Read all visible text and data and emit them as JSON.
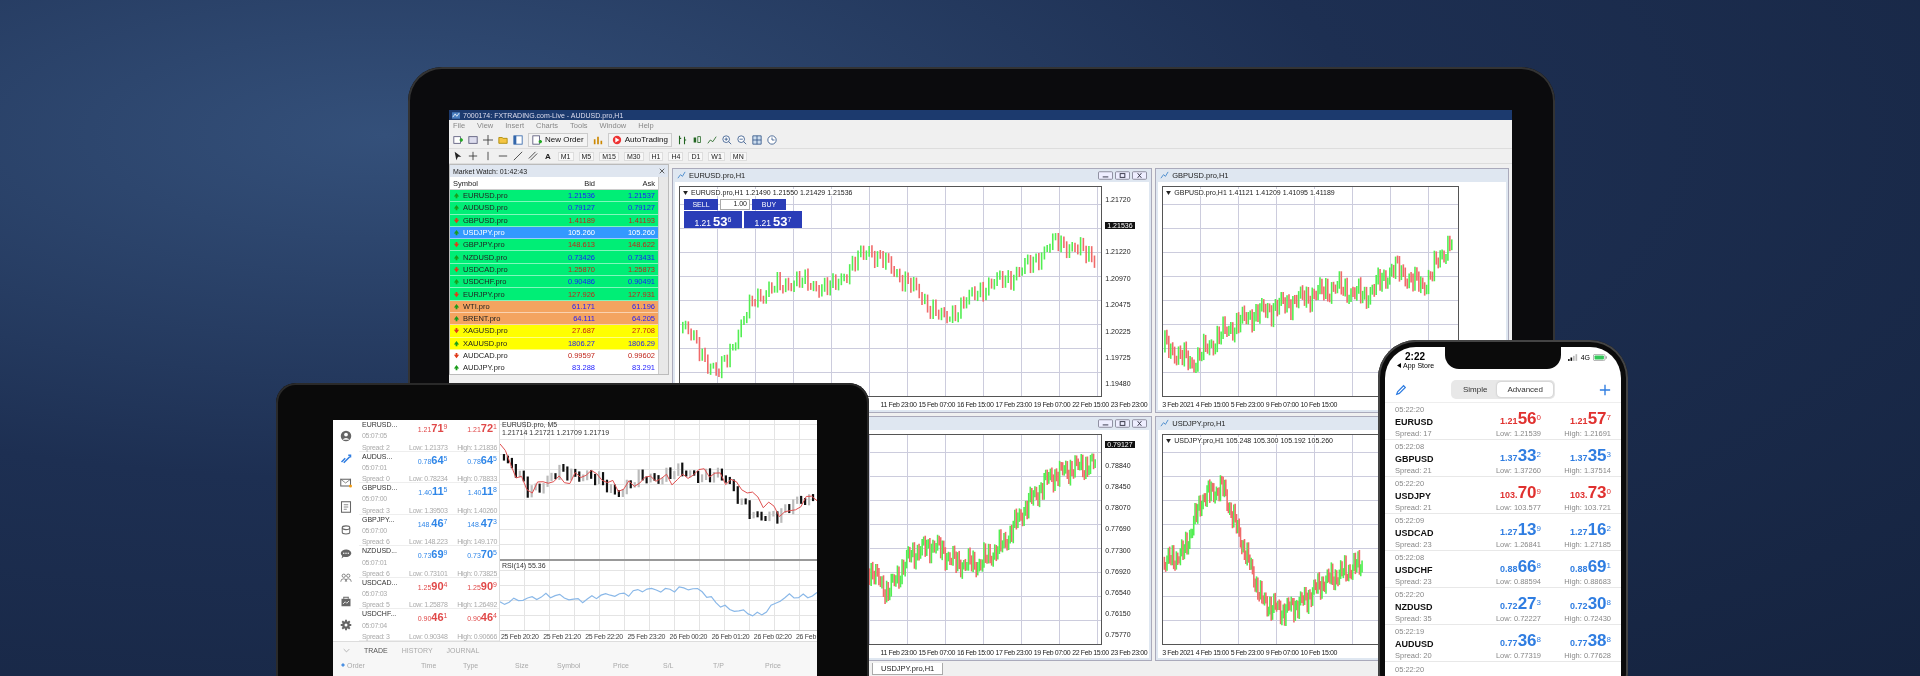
{
  "desktop": {
    "title": "7000174: FXTRADING.com-Live - AUDUSD.pro,H1",
    "menu": [
      "File",
      "View",
      "Insert",
      "Charts",
      "Tools",
      "Window",
      "Help"
    ],
    "toolbar_buttons": [
      "New Order",
      "AutoTrading"
    ],
    "text_tool": "A",
    "timeframes": [
      "M1",
      "M5",
      "M15",
      "M30",
      "H1",
      "H4",
      "D1",
      "W1",
      "MN"
    ],
    "market_watch": {
      "title": "Market Watch: 01:42:43",
      "columns": [
        "Symbol",
        "Bid",
        "Ask"
      ],
      "rows": [
        {
          "symbol": "EURUSD.pro",
          "bid": "1.21536",
          "ask": "1.21537",
          "falling": false,
          "color": "#00ee76",
          "selected": false
        },
        {
          "symbol": "AUDUSD.pro",
          "bid": "0.79127",
          "ask": "0.79127",
          "falling": false,
          "color": "#00ee76",
          "selected": false
        },
        {
          "symbol": "GBPUSD.pro",
          "bid": "1.41189",
          "ask": "1.41193",
          "falling": true,
          "color": "#00ee76",
          "selected": false
        },
        {
          "symbol": "USDJPY.pro",
          "bid": "105.260",
          "ask": "105.260",
          "falling": false,
          "selected": true
        },
        {
          "symbol": "GBPJPY.pro",
          "bid": "148.613",
          "ask": "148.622",
          "falling": true,
          "color": "#00ee76",
          "selected": false
        },
        {
          "symbol": "NZDUSD.pro",
          "bid": "0.73426",
          "ask": "0.73431",
          "falling": false,
          "color": "#00ee76",
          "selected": false
        },
        {
          "symbol": "USDCAD.pro",
          "bid": "1.25870",
          "ask": "1.25873",
          "falling": true,
          "color": "#00ee76",
          "selected": false
        },
        {
          "symbol": "USDCHF.pro",
          "bid": "0.90486",
          "ask": "0.90491",
          "falling": false,
          "color": "#00ee76",
          "selected": false
        },
        {
          "symbol": "EURJPY.pro",
          "bid": "127.926",
          "ask": "127.931",
          "falling": true,
          "color": "#00ee76",
          "selected": false
        },
        {
          "symbol": "WTI.pro",
          "bid": "61.171",
          "ask": "61.196",
          "falling": false,
          "color": "#f4a460",
          "selected": false
        },
        {
          "symbol": "BRENT.pro",
          "bid": "64.111",
          "ask": "64.205",
          "falling": false,
          "color": "#f4a460",
          "selected": false
        },
        {
          "symbol": "XAGUSD.pro",
          "bid": "27.687",
          "ask": "27.708",
          "falling": true,
          "color": "#ffff00",
          "selected": false
        },
        {
          "symbol": "XAUUSD.pro",
          "bid": "1806.27",
          "ask": "1806.29",
          "falling": false,
          "color": "#ffff00",
          "selected": false
        },
        {
          "symbol": "AUDCAD.pro",
          "bid": "0.99597",
          "ask": "0.99602",
          "falling": true,
          "color": "#ffffff",
          "selected": false
        },
        {
          "symbol": "AUDJPY.pro",
          "bid": "83.288",
          "ask": "83.291",
          "falling": false,
          "color": "#ffffff",
          "selected": false
        }
      ]
    },
    "chart_rows": [
      [
        {
          "title": "EURUSD.pro,H1",
          "info": "EURUSD.pro,H1 1.21490 1.21550 1.21429 1.21536",
          "price_tag": "1.21536",
          "price_labels": [
            "1.21720",
            "1.21220",
            "1.20970",
            "1.20475",
            "1.20225",
            "1.19725",
            "1.19480"
          ],
          "time_labels": [
            "11 Feb 23:00",
            "15 Feb 07:00",
            "16 Feb 15:00",
            "17 Feb 23:00",
            "19 Feb 07:00",
            "22 Feb 15:00",
            "23 Feb 23:00"
          ],
          "one_click": {
            "sell": "SELL",
            "lots": "1.00",
            "buy": "BUY",
            "sell_price": "1.21**53**$^{6}$",
            "buy_price": "1.21**53**$^{7}$"
          }
        },
        {
          "title": "GBPUSD.pro,H1",
          "info": "GBPUSD.pro,H1 1.41121 1.41209 1.41095 1.41189",
          "time_labels": [
            "3 Feb 2021",
            "4 Feb 15:00",
            "5 Feb 23:00",
            "9 Feb 07:00",
            "10 Feb 15:00"
          ]
        }
      ],
      [
        {
          "price_tag": "0.79127",
          "price_labels": [
            "0.78840",
            "0.78450",
            "0.78070",
            "0.77690",
            "0.77300",
            "0.76920",
            "0.76540",
            "0.76150",
            "0.75770"
          ],
          "time_labels": [
            "11 Feb 23:00",
            "15 Feb 07:00",
            "16 Feb 15:00",
            "17 Feb 23:00",
            "19 Feb 07:00",
            "22 Feb 15:00",
            "23 Feb 23:00"
          ]
        },
        {
          "title": "USDJPY.pro,H1",
          "info": "USDJPY.pro,H1 105.248 105.300 105.192 105.260",
          "time_labels": [
            "3 Feb 2021",
            "4 Feb 15:00",
            "5 Feb 23:00",
            "9 Feb 07:00",
            "10 Feb 15:00"
          ]
        }
      ]
    ],
    "chart_tab": "USDJPY.pro,H1"
  },
  "tablet": {
    "sidebar": [
      {
        "selected": false
      },
      {
        "selected": true
      },
      {
        "selected": false
      },
      {
        "selected": false
      },
      {
        "selected": false
      },
      {
        "selected": false
      },
      {
        "selected": false
      },
      {
        "selected": false
      },
      {
        "selected": false
      }
    ],
    "quotes": [
      {
        "symbol": "EURUSD...",
        "time": "05:07:05",
        "spread": "Spread: 2",
        "bid": "1.21**71**$^{9}$",
        "ask": "1.21**72**$^{1}$",
        "low": "Low: 1.21373",
        "high": "High: 1.21836",
        "falling": true
      },
      {
        "symbol": "AUDUS...",
        "time": "05:07:01",
        "spread": "Spread: 0",
        "bid": "0.78**64**$^{5}$",
        "ask": "0.78**64**$^{5}$",
        "low": "Low: 0.78234",
        "high": "High: 0.78833",
        "falling": false
      },
      {
        "symbol": "GBPUSD...",
        "time": "05:07:00",
        "spread": "Spread: 3",
        "bid": "1.40**11**$^{5}$",
        "ask": "1.40**11**$^{8}$",
        "low": "Low: 1.39503",
        "high": "High: 1.40260",
        "falling": false
      },
      {
        "symbol": "GBPJPY...",
        "time": "05:07:00",
        "spread": "Spread: 6",
        "bid": "148.**46**$^{7}$",
        "ask": "148.**47**$^{3}$",
        "low": "Low: 148.223",
        "high": "High: 149.170",
        "falling": false
      },
      {
        "symbol": "NZDUSD...",
        "time": "05:07:01",
        "spread": "Spread: 6",
        "bid": "0.73**69**$^{9}$",
        "ask": "0.73**70**$^{5}$",
        "low": "Low: 0.73101",
        "high": "High: 0.73825",
        "falling": false
      },
      {
        "symbol": "USDCAD...",
        "time": "05:07:03",
        "spread": "Spread: 5",
        "bid": "1.25**90**$^{4}$",
        "ask": "1.25**90**$^{9}$",
        "low": "Low: 1.25878",
        "high": "High: 1.26492",
        "falling": true
      },
      {
        "symbol": "USDCHF...",
        "time": "05:07:04",
        "spread": "Spread: 3",
        "bid": "0.90**46**$^{1}$",
        "ask": "0.90**46**$^{4}$",
        "low": "Low: 0.90348",
        "high": "High: 0.90666",
        "falling": true
      }
    ],
    "chart": {
      "title": "EURUSD.pro, M5",
      "info": "1.21714 1.21721 1.21709 1.21719",
      "indicator": "RSI(14) 55.36",
      "time_labels": [
        "25 Feb 20:20",
        "25 Feb 21:20",
        "25 Feb 22:20",
        "25 Feb 23:20",
        "26 Feb 00:20",
        "26 Feb 01:20",
        "26 Feb 02:20",
        "26 Feb"
      ]
    },
    "tabs": [
      {
        "label": "TRADE",
        "selected": true
      },
      {
        "label": "HISTORY",
        "selected": false
      },
      {
        "label": "JOURNAL",
        "selected": false
      }
    ],
    "columns": [
      "Order",
      "Time",
      "Type",
      "Size",
      "Symbol",
      "Price",
      "S/L",
      "T/P",
      "Price"
    ]
  },
  "phone": {
    "time": "2:22",
    "back_label": "App Store",
    "network": "4G",
    "segments": [
      {
        "label": "Simple",
        "selected": false
      },
      {
        "label": "Advanced",
        "selected": true
      }
    ],
    "quotes": [
      {
        "time": "05:22:20",
        "symbol": "EURUSD",
        "spread": "Spread: 17",
        "bid": "1.21**56**$^{0}$",
        "ask": "1.21**57**$^{7}$",
        "low": "Low: 1.21539",
        "high": "High: 1.21691",
        "falling": true
      },
      {
        "time": "05:22:08",
        "symbol": "GBPUSD",
        "spread": "Spread: 21",
        "bid": "1.37**33**$^{2}$",
        "ask": "1.37**35**$^{3}$",
        "low": "Low: 1.37260",
        "high": "High: 1.37514",
        "falling": false
      },
      {
        "time": "05:22:20",
        "symbol": "USDJPY",
        "spread": "Spread: 21",
        "bid": "103.**70**$^{9}$",
        "ask": "103.**73**$^{0}$",
        "low": "Low: 103.577",
        "high": "High: 103.721",
        "falling": true
      },
      {
        "time": "05:22:09",
        "symbol": "USDCAD",
        "spread": "Spread: 23",
        "bid": "1.27**13**$^{9}$",
        "ask": "1.27**16**$^{2}$",
        "low": "Low: 1.26841",
        "high": "High: 1.27185",
        "falling": false
      },
      {
        "time": "05:22:08",
        "symbol": "USDCHF",
        "spread": "Spread: 23",
        "bid": "0.88**66**$^{8}$",
        "ask": "0.88**69**$^{1}$",
        "low": "Low: 0.88594",
        "high": "High: 0.88683",
        "falling": false
      },
      {
        "time": "05:22:20",
        "symbol": "NZDUSD",
        "spread": "Spread: 35",
        "bid": "0.72**27**$^{3}$",
        "ask": "0.72**30**$^{8}$",
        "low": "Low: 0.72227",
        "high": "High: 0.72430",
        "falling": false
      },
      {
        "time": "05:22:19",
        "symbol": "AUDUSD",
        "spread": "Spread: 20",
        "bid": "0.77**36**$^{8}$",
        "ask": "0.77**38**$^{8}$",
        "low": "Low: 0.77319",
        "high": "High: 0.77628",
        "falling": false
      }
    ],
    "next_time": "05:22:20"
  }
}
